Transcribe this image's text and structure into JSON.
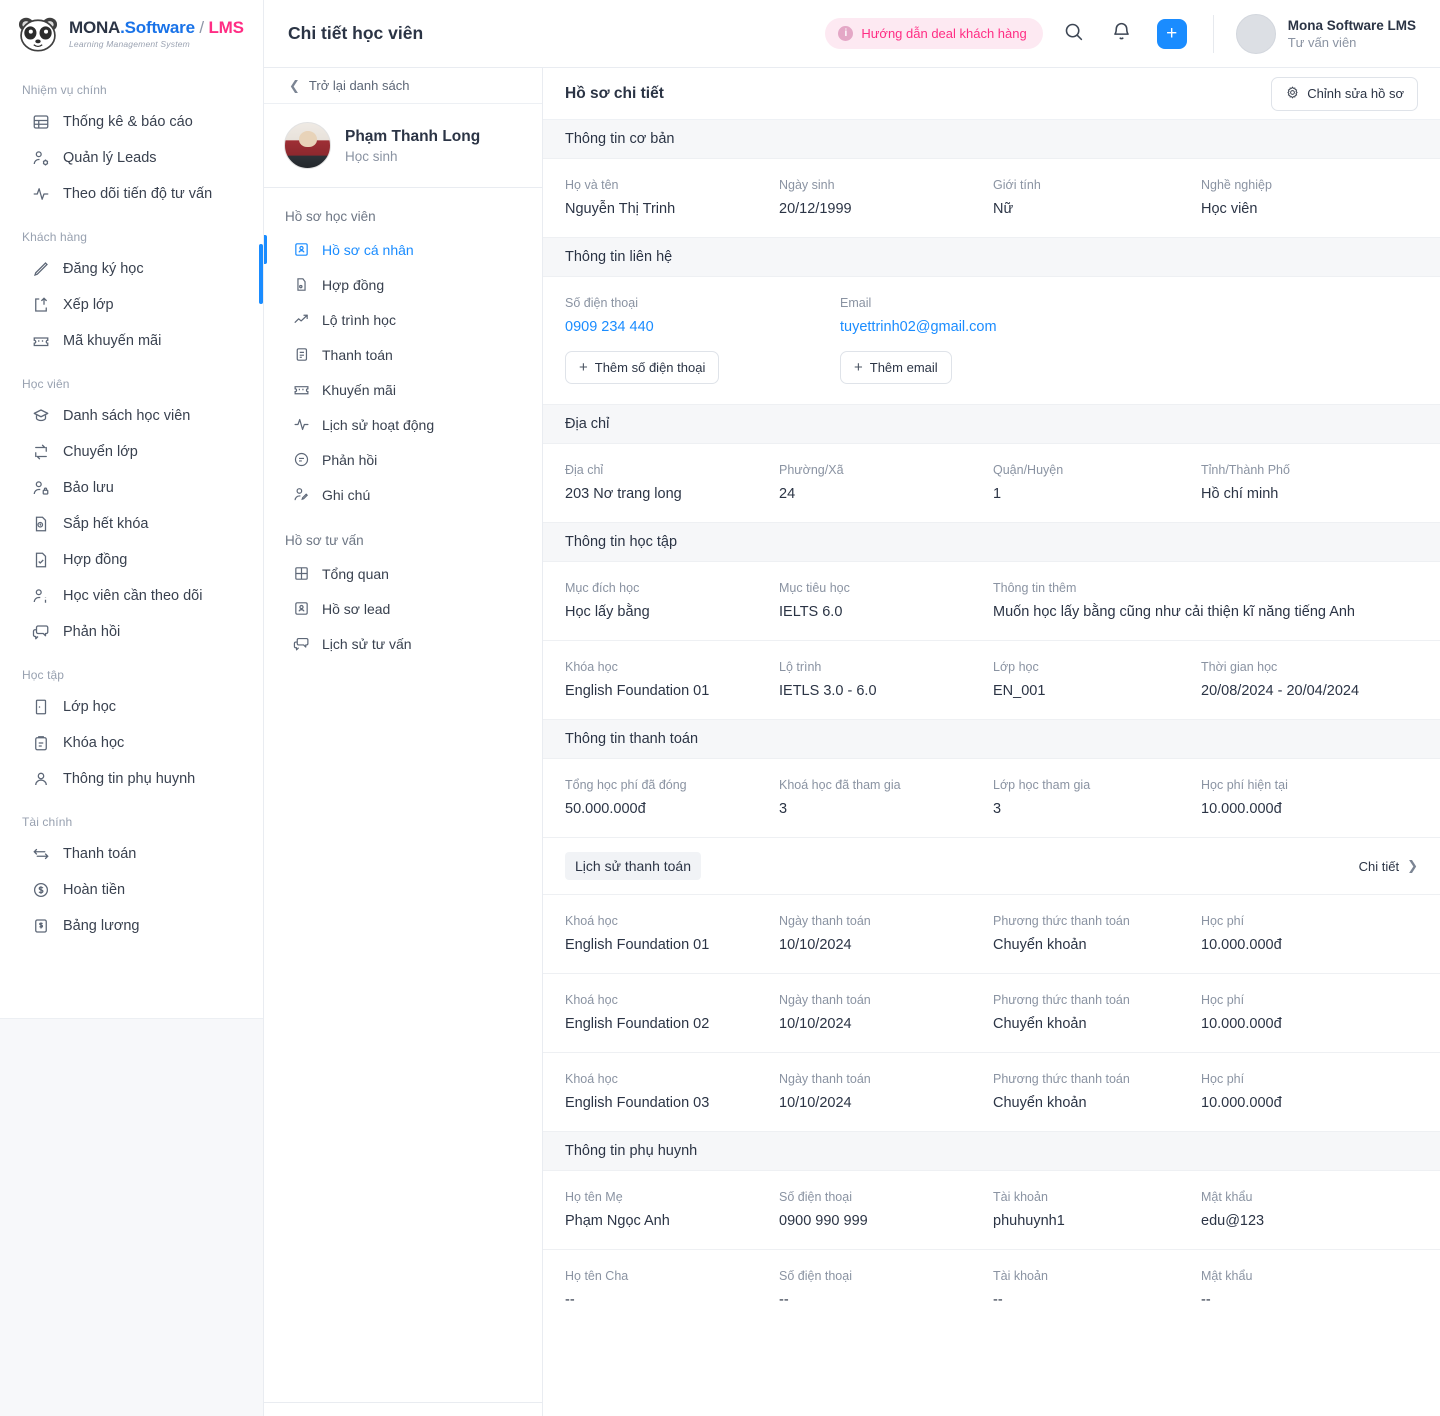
{
  "brand": {
    "name_part1": "MONA",
    "name_part2": ".Software",
    "name_sep": " / ",
    "name_part3": "LMS",
    "subtitle": "Learning Management System"
  },
  "sidebar": {
    "groups": [
      {
        "label": "Nhiệm vụ chính",
        "items": [
          {
            "label": "Thống kê & báo cáo",
            "icon": "table-icon"
          },
          {
            "label": "Quản lý Leads",
            "icon": "user-cog-icon"
          },
          {
            "label": "Theo dõi tiến độ tư vấn",
            "icon": "activity-icon"
          }
        ]
      },
      {
        "label": "Khách hàng",
        "items": [
          {
            "label": "Đăng ký học",
            "icon": "pencil-icon"
          },
          {
            "label": "Xếp lớp",
            "icon": "file-up-icon"
          },
          {
            "label": "Mã khuyến mãi",
            "icon": "ticket-icon"
          }
        ]
      },
      {
        "label": "Học viên",
        "items": [
          {
            "label": "Danh sách học viên",
            "icon": "graduation-cap-icon"
          },
          {
            "label": "Chuyển lớp",
            "icon": "transfer-icon"
          },
          {
            "label": "Bảo lưu",
            "icon": "user-lock-icon"
          },
          {
            "label": "Sắp hết khóa",
            "icon": "file-clock-icon"
          },
          {
            "label": "Hợp đồng",
            "icon": "file-check-icon"
          },
          {
            "label": "Học viên cần theo dõi",
            "icon": "user-info-icon"
          },
          {
            "label": "Phản hồi",
            "icon": "messages-icon"
          }
        ]
      },
      {
        "label": "Học tập",
        "items": [
          {
            "label": "Lớp học",
            "icon": "door-icon"
          },
          {
            "label": "Khóa học",
            "icon": "clipboard-icon"
          },
          {
            "label": "Thông tin phụ huynh",
            "icon": "user-icon"
          }
        ]
      },
      {
        "label": "Tài chính",
        "items": [
          {
            "label": "Thanh toán",
            "icon": "arrows-exchange-icon"
          },
          {
            "label": "Hoàn tiền",
            "icon": "dollar-circle-icon"
          },
          {
            "label": "Bảng lương",
            "icon": "banknote-icon"
          }
        ]
      }
    ]
  },
  "topbar": {
    "title": "Chi tiết học viên",
    "guide_pill": "Hướng dẫn deal khách hàng",
    "guide_icon": "info-icon",
    "search_icon": "search-icon",
    "bell_icon": "bell-icon",
    "plus_icon": "plus-icon",
    "user_name": "Mona Software LMS",
    "user_role": "Tư vấn viên"
  },
  "midcol": {
    "back_label": "Trở lại danh sách",
    "back_icon": "chevron-left-icon",
    "student_name": "Phạm Thanh Long",
    "student_role": "Học sinh",
    "groups": [
      {
        "label": "Hồ sơ học viên",
        "items": [
          {
            "label": "Hồ sơ cá nhân",
            "icon": "id-card-icon",
            "active": true
          },
          {
            "label": "Hợp đồng",
            "icon": "file-contract-icon",
            "active": false
          },
          {
            "label": "Lộ trình học",
            "icon": "trending-up-icon",
            "active": false
          },
          {
            "label": "Thanh toán",
            "icon": "invoice-icon",
            "active": false
          },
          {
            "label": "Khuyến mãi",
            "icon": "ticket-icon",
            "active": false
          },
          {
            "label": "Lịch sử hoạt động",
            "icon": "activity-icon",
            "active": false
          },
          {
            "label": "Phản hồi",
            "icon": "message-icon",
            "active": false
          },
          {
            "label": "Ghi chú",
            "icon": "user-edit-icon",
            "active": false
          }
        ]
      },
      {
        "label": "Hồ sơ tư vấn",
        "items": [
          {
            "label": "Tổng quan",
            "icon": "grid-icon",
            "active": false
          },
          {
            "label": "Hồ sơ lead",
            "icon": "id-card-icon",
            "active": false
          },
          {
            "label": "Lịch sử tư vấn",
            "icon": "messages-icon",
            "active": false
          }
        ]
      }
    ]
  },
  "main": {
    "title": "Hồ sơ chi tiết",
    "edit_button": "Chỉnh sửa hồ sơ",
    "edit_icon": "gear-icon",
    "sections": {
      "basic": {
        "title": "Thông tin cơ bản",
        "fields": [
          {
            "label": "Họ và tên",
            "value": "Nguyễn Thị Trinh"
          },
          {
            "label": "Ngày sinh",
            "value": "20/12/1999"
          },
          {
            "label": "Giới tính",
            "value": "Nữ"
          },
          {
            "label": "Nghề nghiệp",
            "value": "Học viên"
          }
        ]
      },
      "contact": {
        "title": "Thông tin liên hệ",
        "phone_label": "Số điện thoại",
        "phone_value": "0909 234 440",
        "phone_add": "Thêm số điện thoại",
        "email_label": "Email",
        "email_value": "tuyettrinh02@gmail.com",
        "email_add": "Thêm email"
      },
      "address": {
        "title": "Địa chỉ",
        "fields": [
          {
            "label": "Địa chỉ",
            "value": "203 Nơ trang long"
          },
          {
            "label": "Phường/Xã",
            "value": "24"
          },
          {
            "label": "Quận/Huyện",
            "value": "1"
          },
          {
            "label": "Tỉnh/Thành Phố",
            "value": "Hồ chí minh"
          }
        ]
      },
      "study": {
        "title": "Thông tin học tập",
        "row1": [
          {
            "label": "Mục đích học",
            "value": "Học lấy bằng"
          },
          {
            "label": "Mục tiêu học",
            "value": "IELTS 6.0"
          },
          {
            "label": "Thông tin thêm",
            "value": "Muốn học lấy bằng cũng như cải thiện kĩ năng tiếng Anh"
          }
        ],
        "row2": [
          {
            "label": "Khóa học",
            "value": "English Foundation 01"
          },
          {
            "label": "Lộ trình",
            "value": "IETLS 3.0 - 6.0"
          },
          {
            "label": "Lớp học",
            "value": "EN_001"
          },
          {
            "label": "Thời gian học",
            "value": "20/08/2024 - 20/04/2024"
          }
        ]
      },
      "payment": {
        "title": "Thông tin thanh toán",
        "fields": [
          {
            "label": "Tổng học phí đã đóng",
            "value": "50.000.000đ"
          },
          {
            "label": "Khoá học đã tham gia",
            "value": "3"
          },
          {
            "label": "Lớp học tham gia",
            "value": "3"
          },
          {
            "label": "Học phí hiện tại",
            "value": "10.000.000đ"
          }
        ]
      },
      "history": {
        "chip": "Lịch sử thanh toán",
        "detail_label": "Chi tiết",
        "detail_icon": "chevron-right-icon",
        "columns": [
          "Khoá học",
          "Ngày thanh toán",
          "Phương thức thanh toán",
          "Học phí"
        ],
        "rows": [
          {
            "course": "English Foundation 01",
            "date": "10/10/2024",
            "method": "Chuyển khoản",
            "fee": "10.000.000đ"
          },
          {
            "course": "English Foundation 02",
            "date": "10/10/2024",
            "method": "Chuyển khoản",
            "fee": "10.000.000đ"
          },
          {
            "course": "English Foundation 03",
            "date": "10/10/2024",
            "method": "Chuyển khoản",
            "fee": "10.000.000đ"
          }
        ]
      },
      "parents": {
        "title": "Thông tin phụ huynh",
        "mother": [
          {
            "label": "Họ tên Mẹ",
            "value": "Phạm Ngọc Anh"
          },
          {
            "label": "Số điện thoại",
            "value": "0900 990 999"
          },
          {
            "label": "Tài khoản",
            "value": "phuhuynh1"
          },
          {
            "label": "Mật khẩu",
            "value": "edu@123"
          }
        ],
        "father": [
          {
            "label": "Họ tên Cha",
            "value": "--"
          },
          {
            "label": "Số điện thoại",
            "value": "--"
          },
          {
            "label": "Tài khoản",
            "value": "--"
          },
          {
            "label": "Mật khẩu",
            "value": "--"
          }
        ]
      }
    }
  },
  "colors": {
    "accent_blue": "#1a8cff",
    "brand_pink": "#ff2d84",
    "brand_blue": "#1a73e8",
    "section_bg": "#f6f7f9",
    "muted_text": "#8a93a2"
  }
}
